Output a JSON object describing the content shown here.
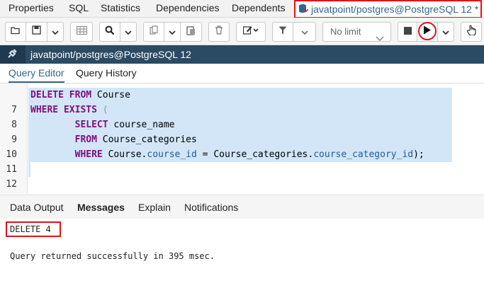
{
  "tabs": {
    "properties": "Properties",
    "sql": "SQL",
    "statistics": "Statistics",
    "dependencies": "Dependencies",
    "dependents": "Dependents",
    "query_tab": "javatpoint/postgres@PostgreSQL 12 *"
  },
  "toolbar": {
    "limit_value": "No limit",
    "icons": [
      "open-folder-icon",
      "save-icon",
      "chevron-down-icon",
      "grid-icon",
      "search-icon",
      "chevron-down-icon",
      "copy-icon",
      "chevron-down-icon",
      "paste-icon",
      "delete-icon",
      "edit-icon",
      "chevron-down-icon",
      "filter-icon",
      "chevron-down-icon",
      "stop-icon",
      "execute-icon",
      "chevron-down-icon",
      "hand-icon"
    ]
  },
  "connection": {
    "label": "javatpoint/postgres@PostgreSQL 12"
  },
  "editor_tabs": {
    "query_editor": "Query Editor",
    "query_history": "Query History"
  },
  "editor": {
    "line_numbers": [
      "7",
      "8",
      "9",
      "10",
      "11",
      "12"
    ],
    "lines": [
      {
        "kw1": "DELETE",
        "sp1": " ",
        "kw2": "FROM",
        "rest": " Course"
      },
      {
        "kw1": "WHERE",
        "sp1": " ",
        "kw2": "EXISTS",
        "rest": " ("
      },
      {
        "indent": "        ",
        "kw1": "SELECT",
        "rest": " course_name"
      },
      {
        "indent": "        ",
        "kw1": "FROM",
        "rest": " Course_categories"
      },
      {
        "indent": "        ",
        "kw1": "WHERE",
        "t1": " Course.",
        "f1": "course_id",
        "t2": " = Course_categories.",
        "f2": "course_category_id",
        "t3": ");"
      }
    ]
  },
  "result_tabs": {
    "data_output": "Data Output",
    "messages": "Messages",
    "explain": "Explain",
    "notifications": "Notifications"
  },
  "messages": {
    "result": "DELETE 4",
    "status": "Query returned successfully in 395 msec."
  },
  "colors": {
    "highlight": "#e0131a",
    "accent": "#326690",
    "conn_bar": "#2b4a63",
    "selection": "#d2e6f7"
  }
}
